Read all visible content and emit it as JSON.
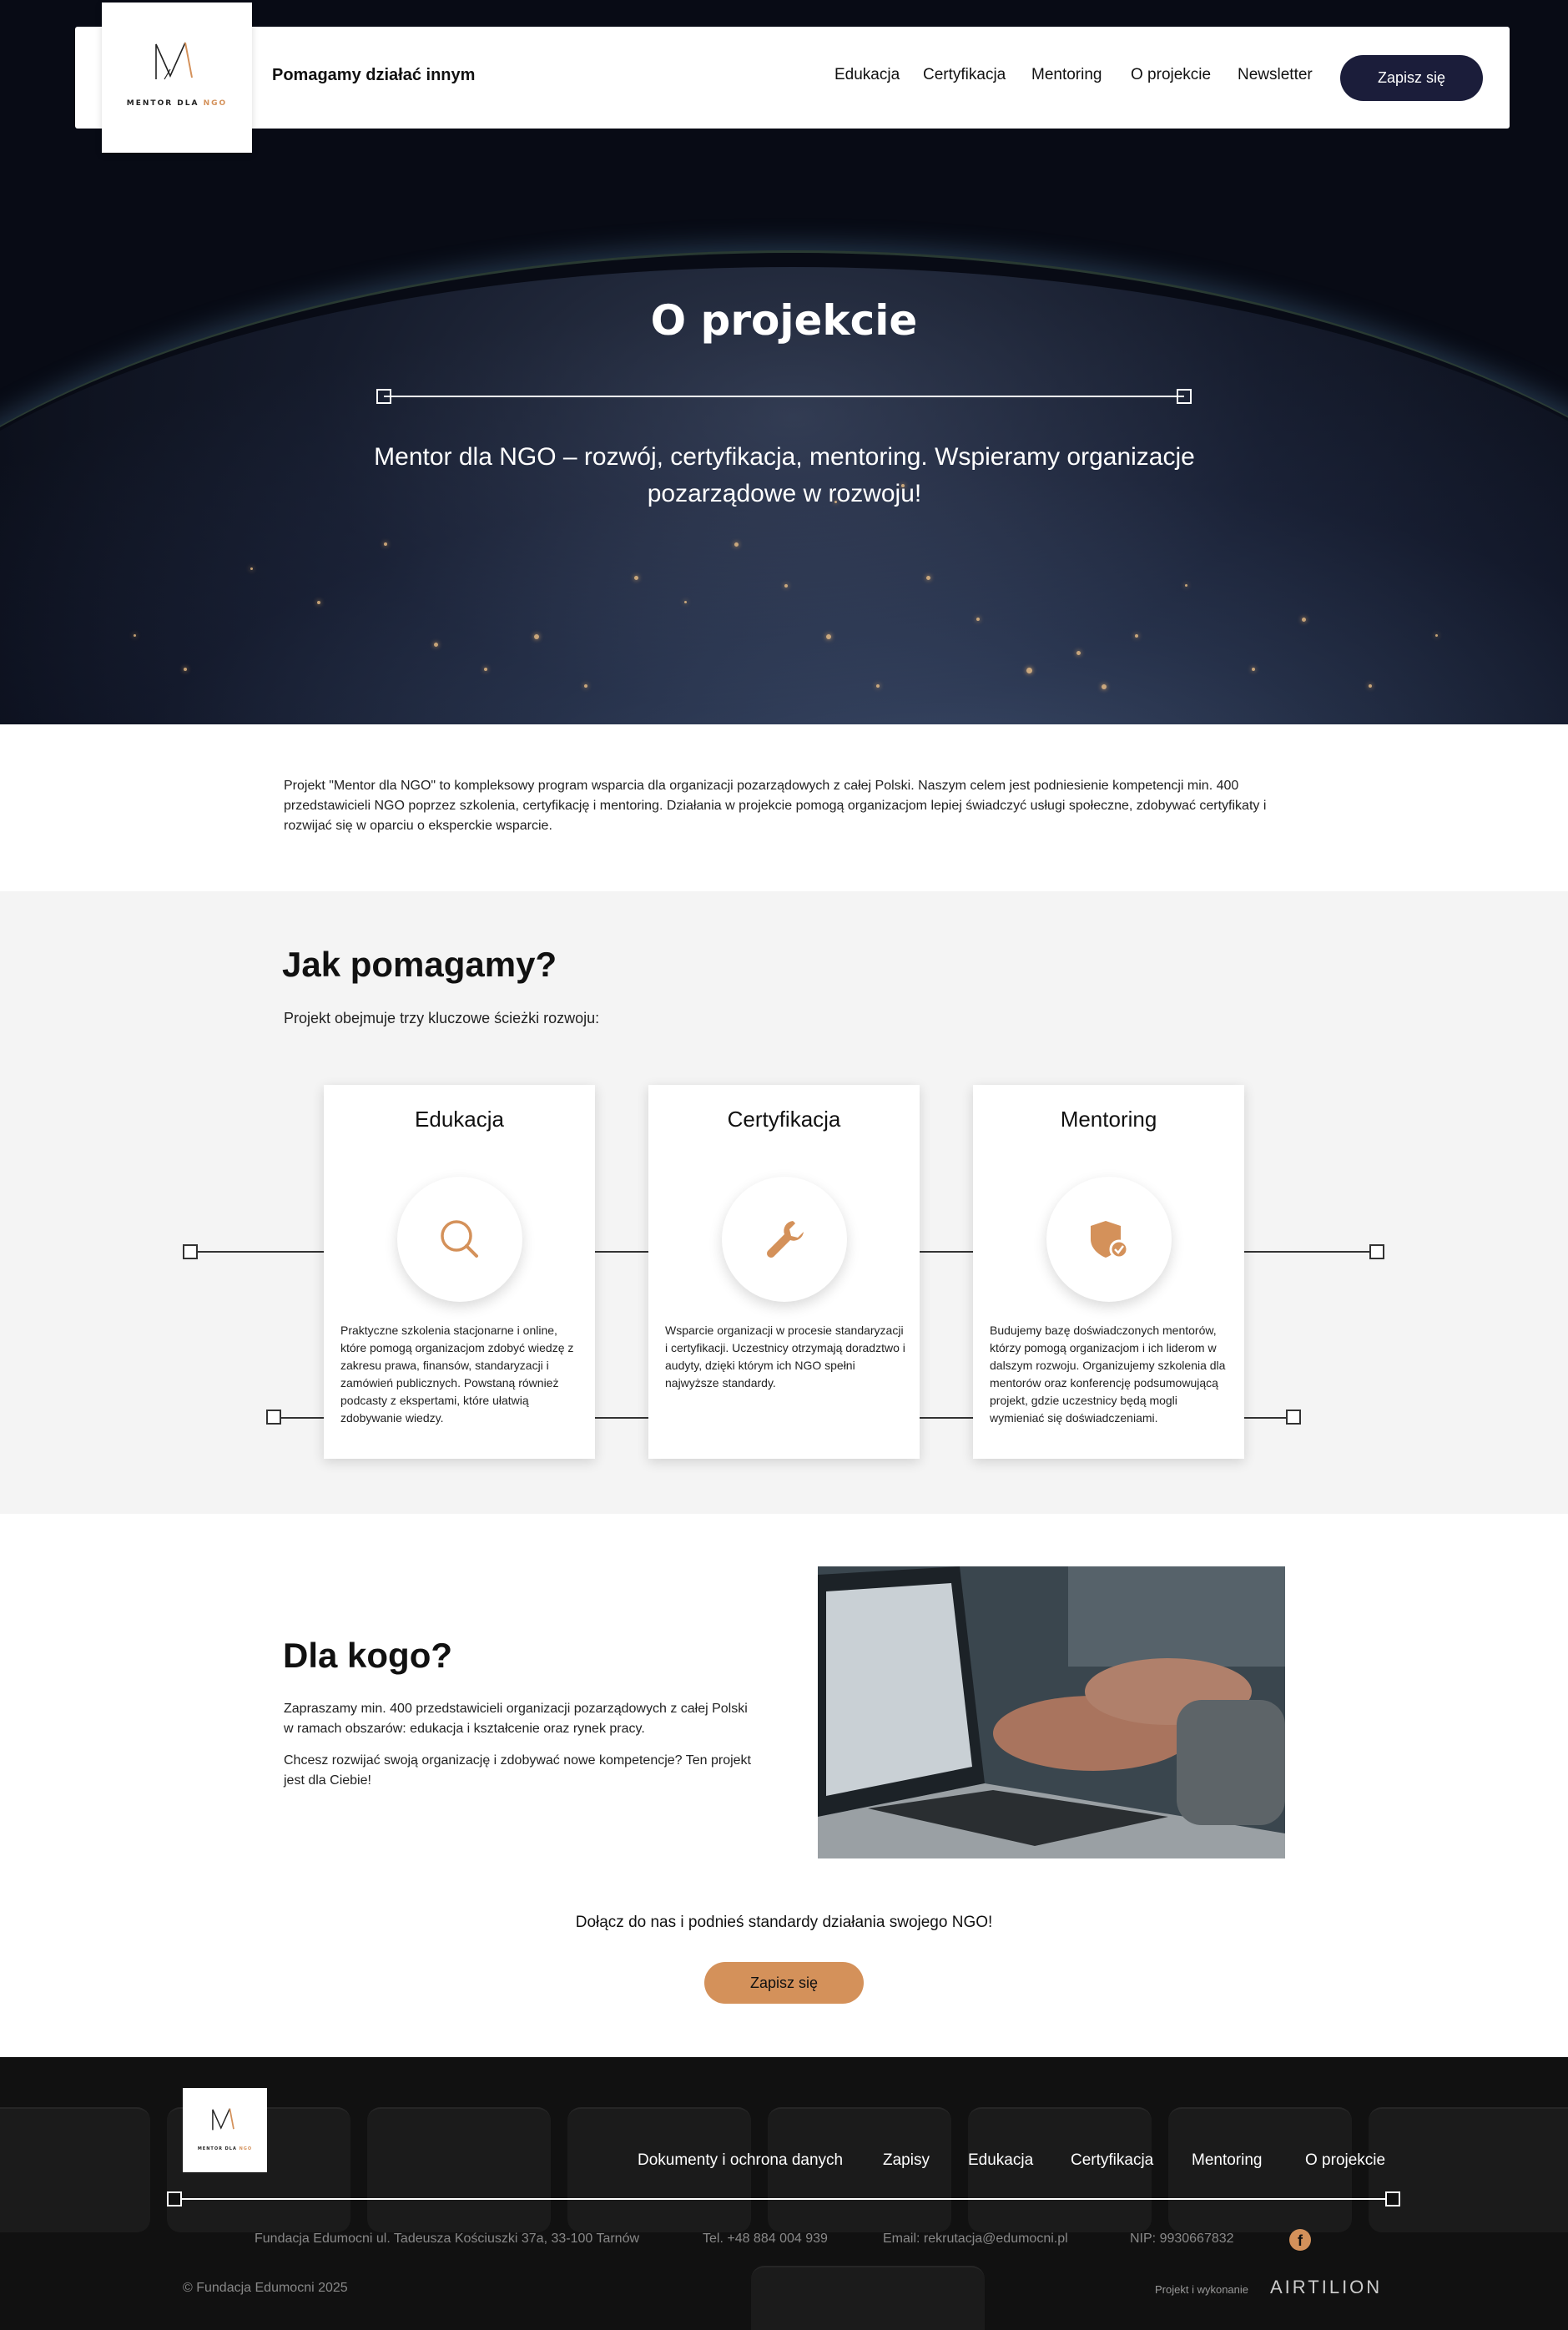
{
  "header": {
    "logo_text_main": "MENTOR DLA",
    "logo_text_accent": "NGO",
    "tagline": "Pomagamy działać innym",
    "nav": [
      "Edukacja",
      "Certyfikacja",
      "Mentoring",
      "O projekcie",
      "Newsletter"
    ],
    "cta": "Zapisz się"
  },
  "hero": {
    "title": "O projekcie",
    "subtitle": "Mentor dla NGO – rozwój, certyfikacja, mentoring. Wspieramy organizacje pozarządowe w rozwoju!"
  },
  "intro": "Projekt \"Mentor dla NGO\" to kompleksowy program wsparcia dla organizacji pozarządowych z całej Polski. Naszym celem jest podniesienie kompetencji min. 400 przedstawicieli NGO poprzez szkolenia, certyfikację i mentoring. Działania w projekcie pomogą organizacjom lepiej świadczyć usługi społeczne, zdobywać certyfikaty i rozwijać się w oparciu o eksperckie wsparcie.",
  "how": {
    "title": "Jak pomagamy?",
    "subtitle": "Projekt obejmuje trzy kluczowe ścieżki rozwoju:",
    "cards": [
      {
        "title": "Edukacja",
        "icon": "search-icon",
        "text": "Praktyczne szkolenia stacjonarne i online, które pomogą organizacjom zdobyć wiedzę z zakresu prawa, finansów, standaryzacji i zamówień publicznych. Powstaną również podcasty z ekspertami, które ułatwią zdobywanie wiedzy."
      },
      {
        "title": "Certyfikacja",
        "icon": "wrench-icon",
        "text": "Wsparcie organizacji w procesie standaryzacji i certyfikacji. Uczestnicy otrzymają doradztwo i audyty, dzięki którym ich NGO spełni najwyższe standardy."
      },
      {
        "title": "Mentoring",
        "icon": "shield-check-icon",
        "text": "Budujemy bazę doświadczonych mentorów, którzy pomogą organizacjom i ich liderom w dalszym rozwoju. Organizujemy szkolenia dla mentorów oraz konferencję podsumowującą projekt, gdzie uczestnicy będą mogli wymieniać się doświadczeniami."
      }
    ]
  },
  "who": {
    "title": "Dla kogo?",
    "p1": "Zapraszamy min. 400 przedstawicieli organizacji pozarządowych z całej Polski w ramach obszarów: edukacja i kształcenie oraz rynek pracy.",
    "p2": "Chcesz rozwijać swoją organizację i zdobywać nowe kompetencje? Ten projekt jest dla Ciebie!"
  },
  "join": {
    "text": "Dołącz do nas i podnieś standardy działania swojego NGO!",
    "cta": "Zapisz się"
  },
  "footer": {
    "logo_text_main": "MENTOR DLA",
    "logo_text_accent": "NGO",
    "links": [
      "Dokumenty i ochrona danych",
      "Zapisy",
      "Edukacja",
      "Certyfikacja",
      "Mentoring",
      "O projekcie"
    ],
    "address": "Fundacja Edumocni ul. Tadeusza Kościuszki 37a, 33-100 Tarnów",
    "phone": "Tel. +48 884 004 939",
    "email": "Email: rekrutacja@edumocni.pl",
    "nip": "NIP: 9930667832",
    "social_icon": "facebook-icon",
    "copyright": "© Fundacja Edumocni 2025",
    "credit": "Projekt i wykonanie",
    "brand": "AIRTILION"
  },
  "colors": {
    "accent": "#d4915a",
    "navy": "#1b1d3a",
    "section_bg": "#f4f4f4",
    "footer_bg": "#111111"
  }
}
